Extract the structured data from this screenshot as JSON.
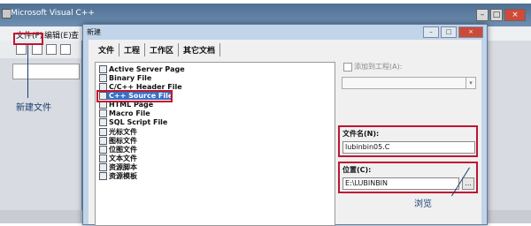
{
  "app": {
    "title": "Microsoft Visual C++",
    "window_buttons": [
      "–",
      "□",
      "×"
    ]
  },
  "menubar": {
    "items": [
      "文件(F)",
      "编辑(E)",
      "查"
    ]
  },
  "annotations": {
    "new_file": "新建文件",
    "browse": "浏览"
  },
  "dialog": {
    "title": "新建",
    "title_buttons": [
      "–",
      "□",
      "×"
    ],
    "tabs": [
      "文件",
      "工程",
      "工作区",
      "其它文档"
    ],
    "file_types": [
      "Active Server Page",
      "Binary File",
      "C/C++ Header File",
      "C++ Source File",
      "HTML Page",
      "Macro File",
      "SQL Script File",
      "光标文件",
      "图标文件",
      "位图文件",
      "文本文件",
      "资源脚本",
      "资源模板"
    ],
    "selected_index": 3,
    "add_to_project": {
      "label": "添加到工程(A):",
      "checked": false
    },
    "file_name": {
      "label": "文件名(N):",
      "value": "lubinbin05.C"
    },
    "location": {
      "label": "位置(C):",
      "value": "E:\\LUBINBIN",
      "browse_label": "..."
    }
  },
  "colors": {
    "highlight": "#c0152f",
    "annotation_text": "#1a3d73",
    "selection": "#3a6fc4"
  }
}
